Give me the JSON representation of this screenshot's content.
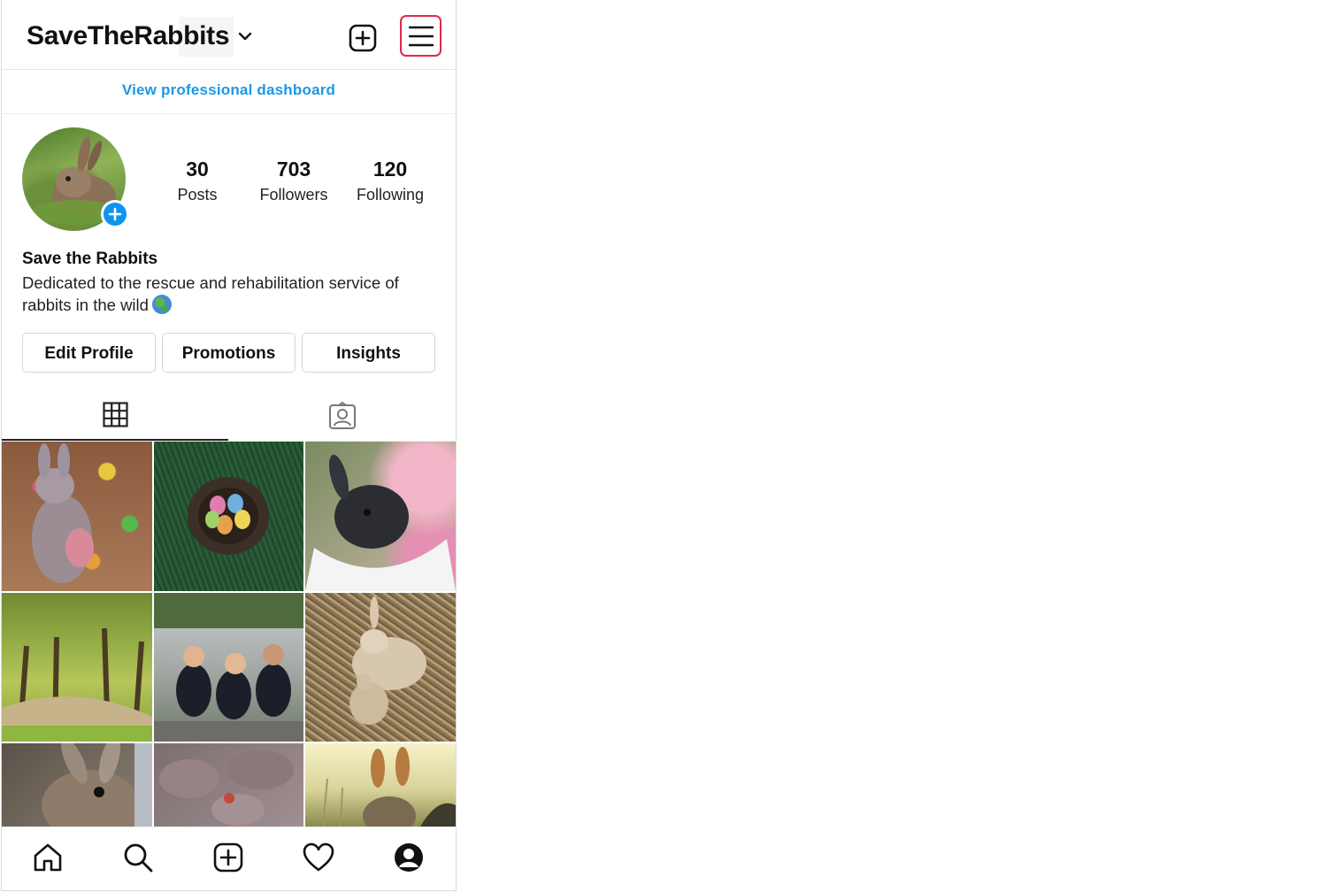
{
  "header": {
    "username": "SaveTheRabbits",
    "icons": [
      "chevron-down-icon",
      "new-post-icon",
      "menu-icon"
    ],
    "menu_highlight_color": "#e0284c"
  },
  "dashboard_link": "View professional dashboard",
  "profile": {
    "stats": [
      {
        "count": "30",
        "label": "Posts"
      },
      {
        "count": "703",
        "label": "Followers"
      },
      {
        "count": "120",
        "label": "Following"
      }
    ],
    "display_name": "Save the Rabbits",
    "bio": "Dedicated to the rescue and rehabilitation service of rabbits in the wild",
    "bio_emoji": "globe-icon"
  },
  "actions": {
    "edit_profile": "Edit Profile",
    "promotions": "Promotions",
    "insights": "Insights"
  },
  "tabs": [
    {
      "name": "grid",
      "icon": "grid-icon",
      "selected": true
    },
    {
      "name": "tagged",
      "icon": "tagged-photos-icon",
      "selected": false
    }
  ],
  "posts": [
    {
      "subject": "toy rabbit with easter eggs"
    },
    {
      "subject": "nest with easter eggs on grass"
    },
    {
      "subject": "black rabbit in white basket"
    },
    {
      "subject": "tree-lined park path"
    },
    {
      "subject": "volunteers group photo"
    },
    {
      "subject": "two rabbits on straw"
    },
    {
      "subject": "wild rabbit closeup"
    },
    {
      "subject": "rabbits in pen"
    },
    {
      "subject": "rabbit in tall grass"
    }
  ],
  "bottom_nav": [
    "home-icon",
    "search-icon",
    "create-icon",
    "activity-heart-icon",
    "profile-icon"
  ],
  "colors": {
    "link_blue": "#1d97e4",
    "avatar_plus_blue": "#0d95f0",
    "border": "#dbdbdb"
  }
}
